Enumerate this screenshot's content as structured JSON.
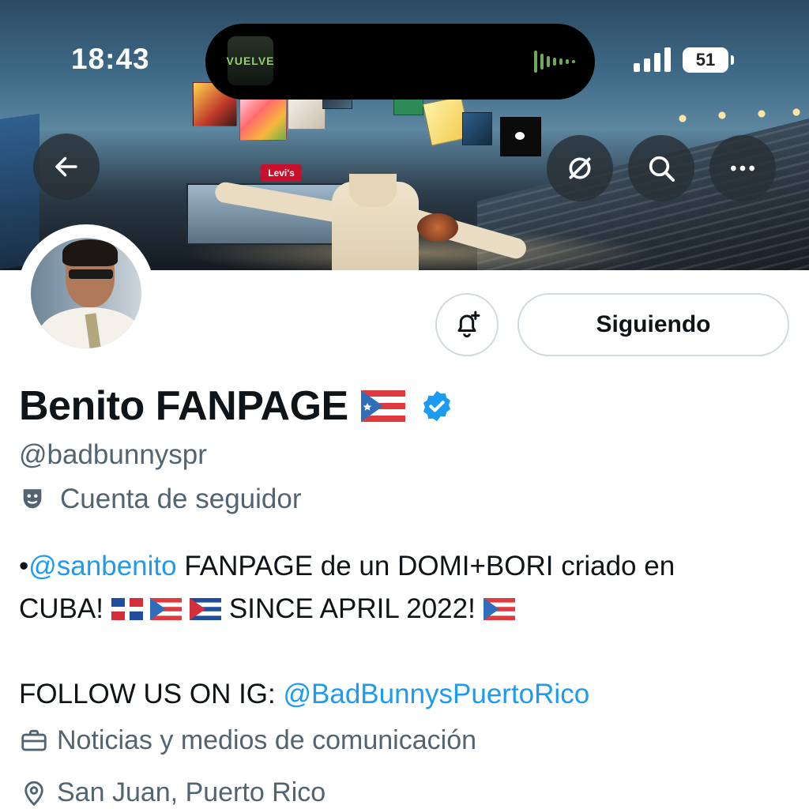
{
  "status_bar": {
    "time": "18:43",
    "battery": "51",
    "now_playing_art_text": "VUELVE"
  },
  "banner": {
    "sign_text": "Levi's"
  },
  "header": {
    "back_icon": "arrow-left-icon",
    "translate_icon": "translate-icon",
    "search_icon": "search-icon",
    "more_icon": "more-horizontal-icon"
  },
  "profile": {
    "display_name": "Benito FANPAGE",
    "flag_icon": "puerto-rico-flag-icon",
    "verified_color": "#1d9bf0",
    "handle": "@badbunnyspr",
    "account_label": "Cuenta de seguidor",
    "bio": {
      "line1_bullet": "•",
      "line1_mention": "@sanbenito",
      "line1_text": " FANPAGE de un DOMI+BORI criado en",
      "line2_start": "CUBA! ",
      "line2_text": " SINCE APRIL 2022! ",
      "line4_text": "FOLLOW US ON IG: ",
      "line4_link": "@BadBunnysPuertoRico"
    },
    "category": "Noticias y medios de comunicación",
    "location": "San Juan, Puerto Rico"
  },
  "actions": {
    "notify_icon": "bell-plus-icon",
    "follow_label": "Siguiendo"
  },
  "colors": {
    "link": "#1d9bf0",
    "secondary_text": "#536471",
    "primary_text": "#0f1419",
    "border": "#cfd9de"
  }
}
